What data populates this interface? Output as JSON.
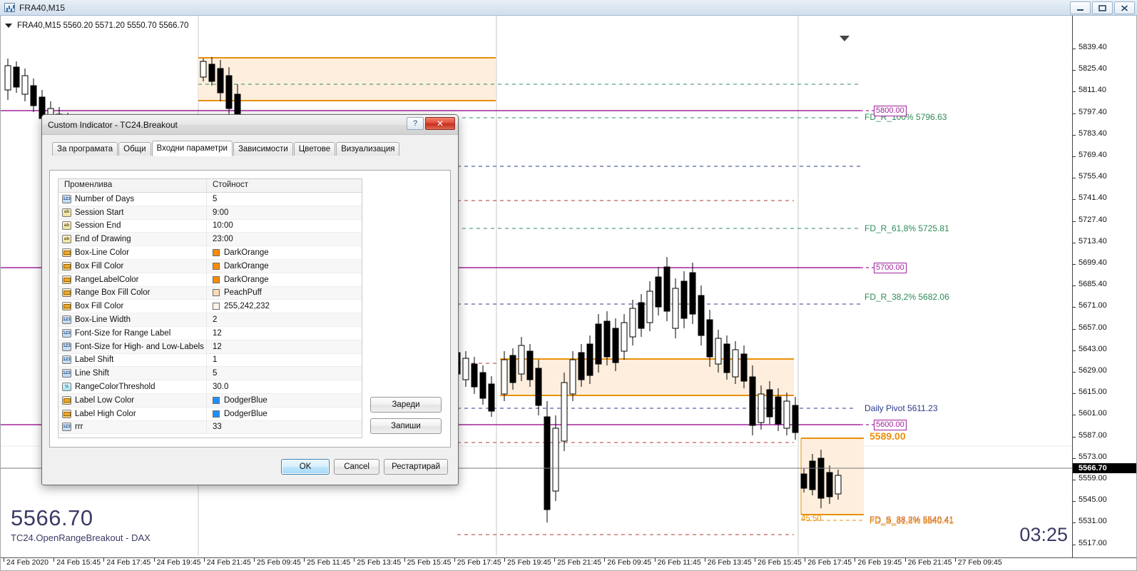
{
  "titlebar": {
    "title": "FRA40,M15",
    "icon": "chart-window-icon",
    "minimize": "–",
    "maximize": "▭",
    "close": "✕"
  },
  "chart": {
    "ohlc": "FRA40,M15  5560.20 5571.20 5550.70 5566.70",
    "watermark_price": "5566.70",
    "watermark_name": "TC24.OpenRangeBreakout - DAX",
    "countdown": "03:25",
    "current_price": "5566.70",
    "price_ticks": [
      "5839.40",
      "5825.40",
      "5811.40",
      "5797.40",
      "5783.40",
      "5769.40",
      "5755.40",
      "5741.40",
      "5727.40",
      "5713.40",
      "5699.40",
      "5685.40",
      "5671.00",
      "5657.00",
      "5643.00",
      "5629.00",
      "5615.00",
      "5601.00",
      "5587.00",
      "5573.00",
      "5559.00",
      "5545.00",
      "5531.00",
      "5517.00"
    ],
    "time_ticks": [
      "24 Feb 2020",
      "24 Feb 15:45",
      "24 Feb 17:45",
      "24 Feb 19:45",
      "24 Feb 21:45",
      "25 Feb 09:45",
      "25 Feb 11:45",
      "25 Feb 13:45",
      "25 Feb 15:45",
      "25 Feb 17:45",
      "25 Feb 19:45",
      "25 Feb 21:45",
      "26 Feb 09:45",
      "26 Feb 11:45",
      "26 Feb 13:45",
      "26 Feb 15:45",
      "26 Feb 17:45",
      "26 Feb 19:45",
      "26 Feb 21:45",
      "27 Feb 09:45"
    ],
    "annotations": {
      "fd_r_100": "FD_R_100% 5796.63",
      "fd_r_618": "FD_R_61,8% 5725.81",
      "fd_r_382": "FD_R_38,2% 5682.06",
      "daily_pivot": "Daily Pivot 5611.23",
      "high_label": "5589.00",
      "fd_s_382": "FD_S_38,2% 5540.41",
      "fd_s_618": "FD_S_61,8% 5540.41",
      "session_time": "45:50"
    },
    "price_boxes": [
      "5800.00",
      "5700.00",
      "5600.00"
    ],
    "colors": {
      "bull_candle": "#ffffff",
      "bear_candle": "#000000",
      "box_line": "#e8900c",
      "box_fill": "#fdeedd",
      "pivot_line": "#a0239c",
      "fib_resistance": "#2e8b57",
      "fib_support": "#cc5522",
      "daily_pivot": "#2a3a8c"
    }
  },
  "dialog": {
    "title": "Custom Indicator - TC24.Breakout",
    "help_label": "?",
    "close_label": "✕",
    "tabs": [
      {
        "label": "За програмата",
        "active": false
      },
      {
        "label": "Общи",
        "active": false
      },
      {
        "label": "Входни параметри",
        "active": true
      },
      {
        "label": "Зависимости",
        "active": false
      },
      {
        "label": "Цветове",
        "active": false
      },
      {
        "label": "Визуализация",
        "active": false
      }
    ],
    "table": {
      "headers": [
        "Променлива",
        "Стойност"
      ],
      "rows": [
        {
          "icon": "integer-icon",
          "type": "int",
          "name": "Number of Days",
          "value": "5"
        },
        {
          "icon": "string-icon",
          "type": "str",
          "name": "Session Start",
          "value": "9:00"
        },
        {
          "icon": "string-icon",
          "type": "str",
          "name": "Session End",
          "value": "10:00"
        },
        {
          "icon": "string-icon",
          "type": "str",
          "name": "End of Drawing",
          "value": "23:00"
        },
        {
          "icon": "color-icon",
          "type": "color",
          "name": "Box-Line Color",
          "value": "DarkOrange",
          "swatch": "#ff8c00"
        },
        {
          "icon": "color-icon",
          "type": "color",
          "name": "Box Fill Color",
          "value": "DarkOrange",
          "swatch": "#ff8c00"
        },
        {
          "icon": "color-icon",
          "type": "color",
          "name": "RangeLabelColor",
          "value": "DarkOrange",
          "swatch": "#ff8c00"
        },
        {
          "icon": "color-icon",
          "type": "color",
          "name": "Range Box Fill Color",
          "value": "PeachPuff",
          "swatch": "#ffdab9"
        },
        {
          "icon": "color-icon",
          "type": "color",
          "name": "Box Fill Color",
          "value": "255,242,232",
          "swatch": "#fff2e8"
        },
        {
          "icon": "integer-icon",
          "type": "int",
          "name": "Box-Line Width",
          "value": "2"
        },
        {
          "icon": "integer-icon",
          "type": "int",
          "name": "Font-Size for Range Label",
          "value": "12"
        },
        {
          "icon": "integer-icon",
          "type": "int",
          "name": "Font-Size for High- and Low-Labels",
          "value": "12"
        },
        {
          "icon": "integer-icon",
          "type": "int",
          "name": "Label Shift",
          "value": "1"
        },
        {
          "icon": "integer-icon",
          "type": "int",
          "name": "Line Shift",
          "value": "5"
        },
        {
          "icon": "double-icon",
          "type": "dbl",
          "name": "RangeColorThreshold",
          "value": "30.0"
        },
        {
          "icon": "color-icon",
          "type": "color",
          "name": "Label Low Color",
          "value": "DodgerBlue",
          "swatch": "#1e90ff"
        },
        {
          "icon": "color-icon",
          "type": "color",
          "name": "Label High Color",
          "value": "DodgerBlue",
          "swatch": "#1e90ff"
        },
        {
          "icon": "integer-icon",
          "type": "int",
          "name": "rrr",
          "value": "33"
        }
      ]
    },
    "side_buttons": {
      "load": "Зареди",
      "save": "Запиши"
    },
    "footer_buttons": {
      "ok": "OK",
      "cancel": "Cancel",
      "reset": "Рестартирай"
    }
  }
}
